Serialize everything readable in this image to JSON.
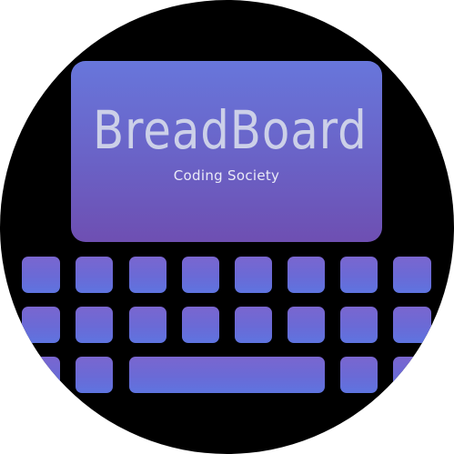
{
  "logo": {
    "title": "BreadBoard",
    "subtitle": "Coding Society",
    "colors": {
      "background": "#000000",
      "screen_top": "#6876db",
      "screen_bottom": "#6e4fb2",
      "key_top": "#7a66cf",
      "key_bottom": "#5e74e0",
      "title_text": "#ccd0e8",
      "subtitle_text": "#e9eaf7"
    },
    "keyboard": {
      "rows": 3,
      "keys_per_row": 8,
      "has_spacebar": true
    }
  }
}
